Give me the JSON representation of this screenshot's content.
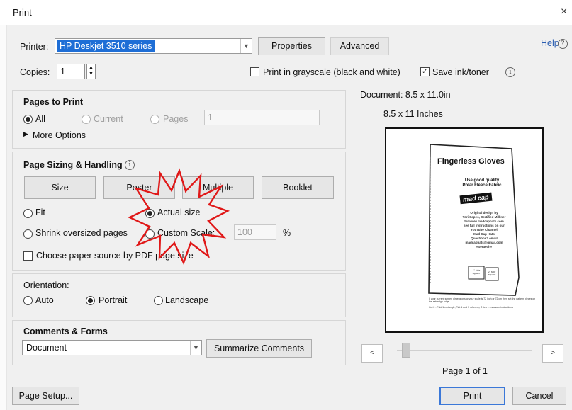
{
  "window": {
    "title": "Print",
    "close_icon": "×"
  },
  "printer": {
    "label": "Printer:",
    "value": "HP Deskjet 3510 series",
    "properties_label": "Properties",
    "advanced_label": "Advanced"
  },
  "help": {
    "label": "Help",
    "icon": "?"
  },
  "copies": {
    "label": "Copies:",
    "value": "1"
  },
  "options": {
    "grayscale_label": "Print in grayscale (black and white)",
    "grayscale_checked": false,
    "save_ink_label": "Save ink/toner",
    "save_ink_checked": true,
    "info_glyph": "i"
  },
  "pages_to_print": {
    "title": "Pages to Print",
    "all_label": "All",
    "current_label": "Current",
    "pages_label": "Pages",
    "pages_value": "1",
    "more_options": "More Options",
    "selected": "All"
  },
  "sizing": {
    "title": "Page Sizing & Handling",
    "tabs": [
      "Size",
      "Poster",
      "Multiple",
      "Booklet"
    ],
    "fit_label": "Fit",
    "actual_size_label": "Actual size",
    "shrink_label": "Shrink oversized pages",
    "custom_scale_label": "Custom Scale:",
    "custom_scale_value": "100",
    "percent": "%",
    "paper_source_label": "Choose paper source by PDF page size",
    "selected": "Actual size"
  },
  "orientation": {
    "title": "Orientation:",
    "auto_label": "Auto",
    "portrait_label": "Portrait",
    "landscape_label": "Landscape",
    "selected": "Portrait"
  },
  "comments": {
    "title": "Comments & Forms",
    "value": "Document",
    "summarize_label": "Summarize Comments"
  },
  "preview": {
    "document_label": "Document: 8.5 x 11.0in",
    "paper_label": "8.5 x 11 Inches",
    "page_counter": "Page 1 of 1",
    "prev_icon": "<",
    "next_icon": ">",
    "sheet": {
      "heading": "Fingerless Gloves",
      "subheading": "Use good quality\nPolar Fleece Fabric",
      "logo": "mad cap",
      "credit_lines": [
        "Original design by",
        "Tori Capes, Certified Milliner",
        "for www.madcaphats.com",
        "see full instructions on our",
        "YouTube Channel",
        "Mad Cap Hats",
        "Questions? email",
        "madcaphats@gmail.com",
        "«Seraech»"
      ],
      "box_labels": [
        "1\" side square",
        "2\" side square"
      ],
      "footer_lines": [
        "If your current screen dimensions or your scale is 72 inch or 72 cm then set the pattern pieces on",
        "the selvedge edge",
        "Cut 2 - Fold 1 rectangle, Flat 1 and 1 rolled up, 2 ties ... measure instructions"
      ]
    }
  },
  "footer": {
    "page_setup_label": "Page Setup...",
    "print_label": "Print",
    "cancel_label": "Cancel"
  },
  "colors": {
    "selection": "#1e6ed6",
    "annotation": "#e01818",
    "link": "#2a5db0",
    "print_border": "#3b78d8"
  }
}
